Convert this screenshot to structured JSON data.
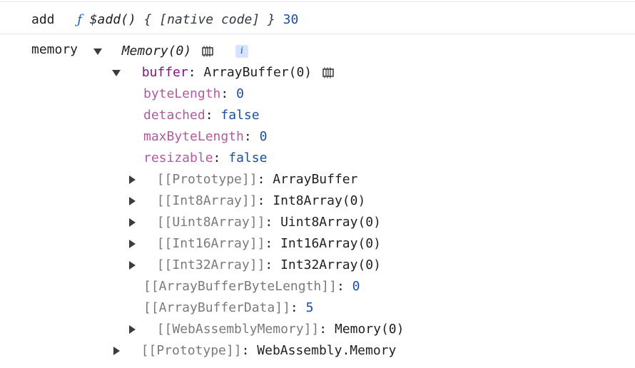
{
  "console": {
    "add_row": {
      "name": "add",
      "fn_symbol": "ƒ",
      "fn_sig": "$add()",
      "fn_body": "{ [native code] }",
      "value": "30"
    },
    "memory_row": {
      "name": "memory",
      "summary": "Memory(0)",
      "info_label": "i"
    },
    "tree": [
      {
        "key": "buffer",
        "value": "ArrayBuffer(0)"
      },
      {
        "key": "byteLength",
        "value": "0"
      },
      {
        "key": "detached",
        "value": "false"
      },
      {
        "key": "maxByteLength",
        "value": "0"
      },
      {
        "key": "resizable",
        "value": "false"
      },
      {
        "key": "[[Prototype]]",
        "value": "ArrayBuffer"
      },
      {
        "key": "[[Int8Array]]",
        "value": "Int8Array(0)"
      },
      {
        "key": "[[Uint8Array]]",
        "value": "Uint8Array(0)"
      },
      {
        "key": "[[Int16Array]]",
        "value": "Int16Array(0)"
      },
      {
        "key": "[[Int32Array]]",
        "value": "Int32Array(0)"
      },
      {
        "key": "[[ArrayBufferByteLength]]",
        "value": "0"
      },
      {
        "key": "[[ArrayBufferData]]",
        "value": "5"
      },
      {
        "key": "[[WebAssemblyMemory]]",
        "value": "Memory(0)"
      },
      {
        "key": "[[Prototype]]",
        "value": "WebAssembly.Memory"
      }
    ],
    "separator": ": "
  }
}
